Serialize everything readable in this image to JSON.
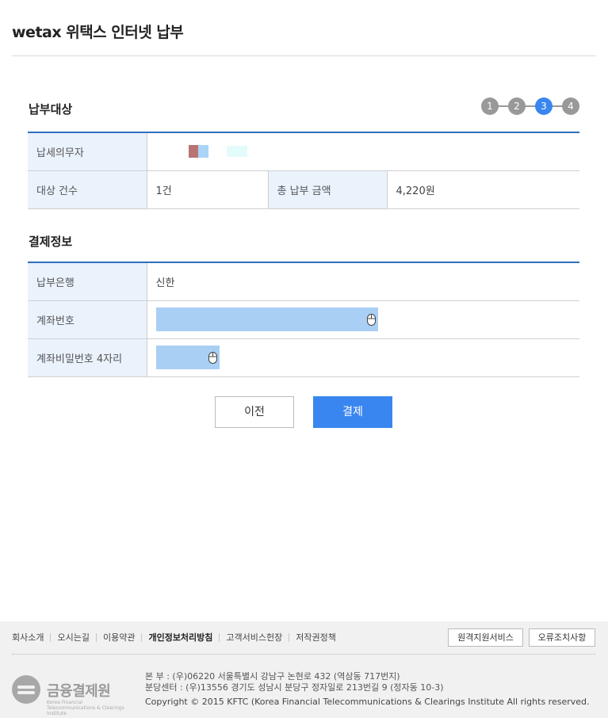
{
  "header": {
    "title": "wetax 위택스 인터넷 납부"
  },
  "steps": {
    "items": [
      "1",
      "2",
      "3",
      "4"
    ],
    "active_index": 2
  },
  "payment_target": {
    "section_title": "납부대상",
    "taxpayer_label": "납세의무자",
    "count_label": "대상 건수",
    "count_value": "1건",
    "total_label": "총 납부 금액",
    "total_value": "4,220원"
  },
  "payment_info": {
    "section_title": "결제정보",
    "bank_label": "납부은행",
    "bank_value": "신한",
    "account_label": "계좌번호",
    "account_value": "",
    "pin_label": "계좌비밀번호 4자리",
    "pin_value": ""
  },
  "buttons": {
    "prev_label": "이전",
    "pay_label": "결제"
  },
  "colors": {
    "accent": "#3a86f0",
    "table_border": "#2f6fbf",
    "header_cell_bg": "#eaf2fc",
    "secure_input_bg": "#a9cff5"
  },
  "footer": {
    "links": [
      "회사소개",
      "오시는길",
      "이용약관",
      "개인정보처리방침",
      "고객서비스헌장",
      "저작권정책"
    ],
    "remote_support_label": "원격지원서비스",
    "error_action_label": "오류조치사항",
    "logo_name": "금융결제원",
    "logo_english": "Korea Financial Telecommunications & Clearings Institute",
    "address_head": "본 부 : (우)06220 서울특별시 강남구 논현로 432 (역삼동 717번지)",
    "address_branch": "분당센터 : (우)13556 경기도 성남시 분당구 정자일로 213번길 9 (정자동 10-3)",
    "copyright": "Copyright © 2015 KFTC (Korea Financial Telecommunications & Clearings Institute All rights reserved."
  }
}
